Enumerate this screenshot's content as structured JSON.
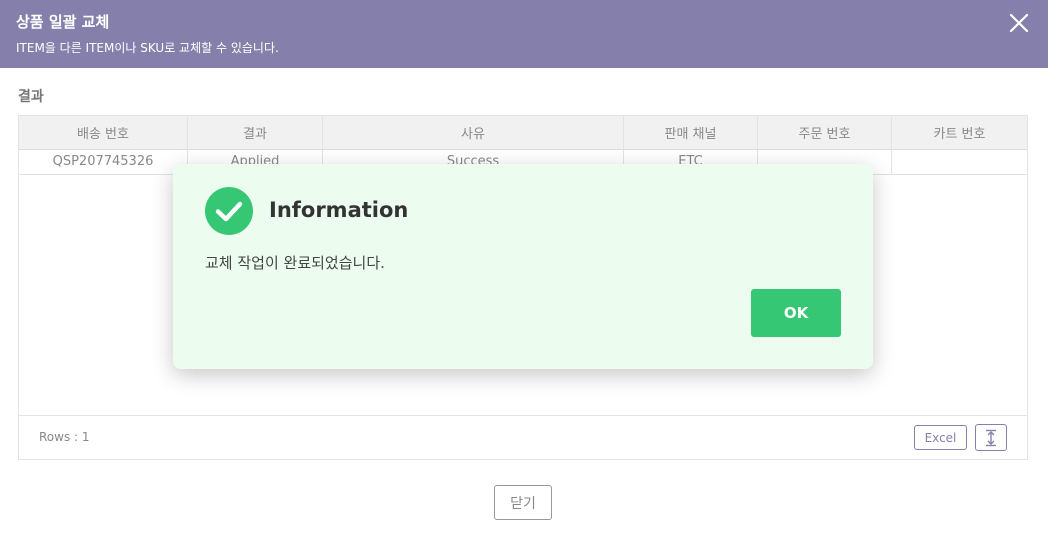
{
  "header": {
    "title": "상품 일괄 교체",
    "subtitle": "ITEM을 다른 ITEM이나 SKU로 교체할 수 있습니다.",
    "close_icon": "close-icon"
  },
  "section": {
    "title": "결과"
  },
  "grid": {
    "columns": [
      "배송 번호",
      "결과",
      "사유",
      "판매 채널",
      "주문 번호",
      "카트 번호"
    ],
    "rows": [
      [
        "QSP207745326",
        "Applied",
        "Success",
        "ETC",
        "",
        ""
      ]
    ],
    "rows_label": "Rows : 1",
    "excel_label": "Excel",
    "expand_icon": "expand-vertical-icon"
  },
  "footer": {
    "close_label": "닫기"
  },
  "dialog": {
    "icon": "check-circle-icon",
    "title": "Information",
    "message": "교체 작업이 완료되었습니다.",
    "ok_label": "OK"
  },
  "colors": {
    "header_bg": "#8480ab",
    "dialog_bg": "#ecfdf0",
    "ok_button": "#35c773"
  }
}
